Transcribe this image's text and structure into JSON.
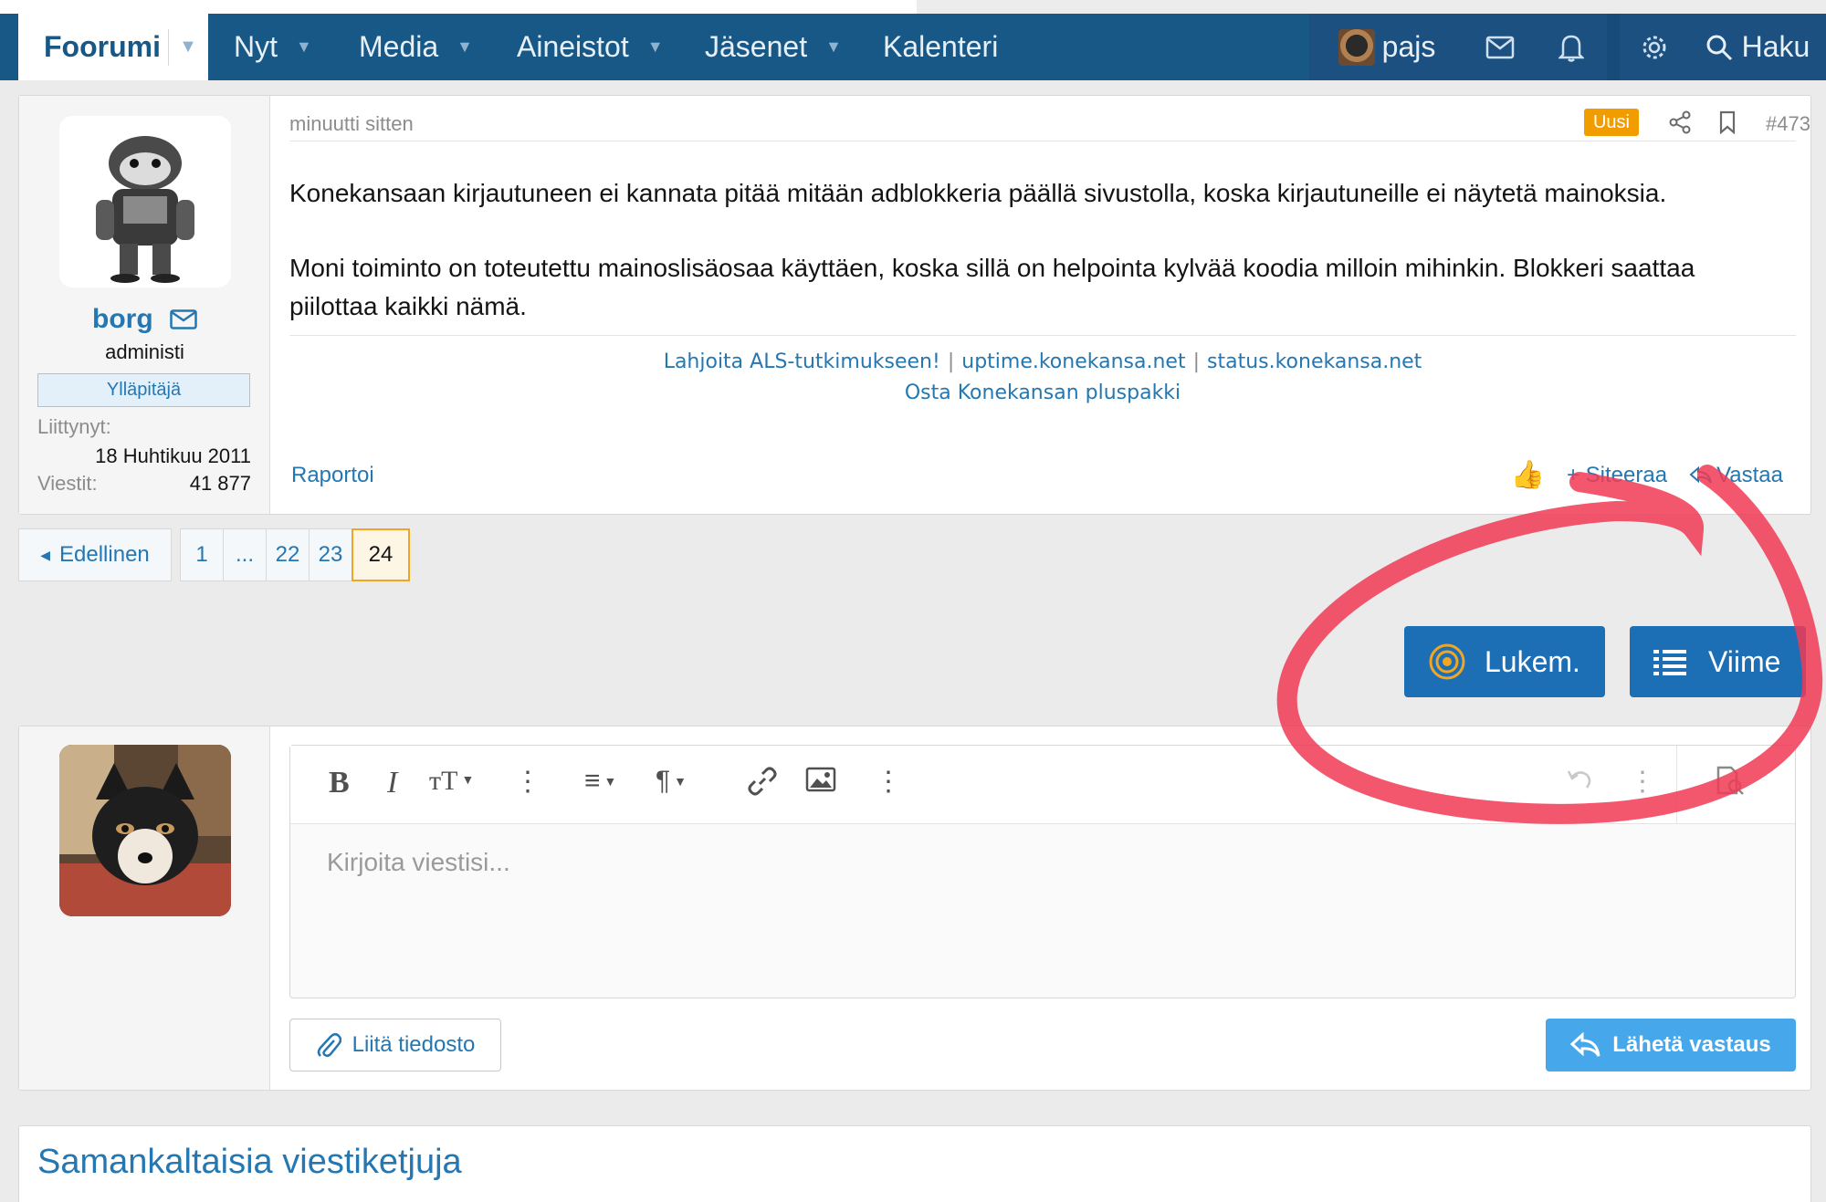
{
  "nav": {
    "home": "Foorumi",
    "items": [
      "Nyt",
      "Media",
      "Aineistot",
      "Jäsenet",
      "Kalenteri"
    ],
    "user": "pajs",
    "search": "Haku"
  },
  "post": {
    "author": {
      "name": "borg",
      "title": "administi",
      "banner": "Ylläpitäjä",
      "joined_label": "Liittynyt:",
      "joined_value": "18 Huhtikuu 2011",
      "posts_label": "Viestit:",
      "posts_value": "41 877"
    },
    "time": "minuutti sitten",
    "badge": "Uusi",
    "number": "#473",
    "paragraphs": [
      "Konekansaan kirjautuneen ei kannata pitää mitään adblokkeria päällä sivustolla, koska kirjautuneille ei näytetä mainoksia.",
      "Moni toiminto on toteutettu mainoslisäosaa käyttäen, koska sillä on helpointa kylvää koodia milloin mihinkin. Blokkeri saattaa piilottaa kaikki nämä."
    ],
    "signature": {
      "link1": "Lahjoita ALS-tutkimukseen!",
      "sep": "|",
      "link2": "uptime.konekansa.net",
      "link3": "status.konekansa.net",
      "link4": "Osta Konekansan pluspakki"
    },
    "report": "Raportoi",
    "quote": "+ Siteeraa",
    "reply": "Vastaa"
  },
  "pagination": {
    "prev": "Edellinen",
    "pages": [
      "1",
      "...",
      "22",
      "23"
    ],
    "current": "24"
  },
  "buttons": {
    "unread": "Lukem.",
    "latest": "Viime"
  },
  "reply_box": {
    "placeholder": "Kirjoita viestisi...",
    "attach": "Liitä tiedosto",
    "send": "Lähetä vastaus"
  },
  "similar": {
    "heading": "Samankaltaisia viestiketjuja"
  },
  "colors": {
    "nav_bg": "#185886",
    "link": "#2577b1",
    "badge": "#f19d00",
    "primary_button": "#1c6fb5",
    "send_button": "#47a7eb",
    "annotation": "#f03a55"
  }
}
